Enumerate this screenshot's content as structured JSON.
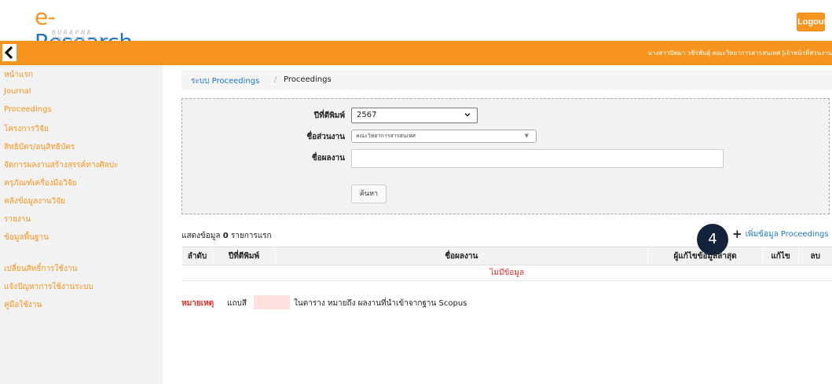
{
  "header": {
    "logo_prefix": "e-",
    "logo_name": "Research",
    "logo_sub": "BURAPHA UNIVERSITY",
    "logout_label": "Logout",
    "user_info": "นางสาวปัทมา วชิรพันธุ์  คณะวิทยาการสารสนเทศ  [เจ้าหน้าที่ส่วนงาน",
    "accent_color": "#f7941d",
    "link_color": "#1f76c9"
  },
  "sidebar": {
    "items": [
      {
        "label": "หน้าแรก"
      },
      {
        "label": "Journal"
      },
      {
        "label": "Proceedings"
      },
      {
        "label": "โครงการวิจัย"
      },
      {
        "label": "สิทธิบัตร/อนุสิทธิบัตร"
      },
      {
        "label": "จัดการผลงานสร้างสรรค์ทางศิลปะ"
      },
      {
        "label": "ครุภัณฑ์เครื่องมือวิจัย"
      },
      {
        "label": "คลังข้อมูลงานวิจัย"
      },
      {
        "label": "รายงาน"
      },
      {
        "label": "ข้อมูลพื้นฐาน"
      },
      {
        "label": "เปลี่ยนสิทธิ์การใช้งาน"
      },
      {
        "label": "แจ้งปัญหาการใช้งานระบบ"
      },
      {
        "label": "คู่มือใช้งาน"
      }
    ]
  },
  "breadcrumb": {
    "parent": "ระบบ Proceedings",
    "separator": "/",
    "current": "Proceedings"
  },
  "search": {
    "year_label": "ปีที่ตีพิมพ์",
    "year_value": "2567",
    "dept_label": "ชื่อส่วนงาน",
    "dept_value": "คณะวิทยาการสารสนเทศ",
    "work_label": "ชื่อผลงาน",
    "work_value": "",
    "search_button": "ค้นหา"
  },
  "results": {
    "count_prefix": "แสดงข้อมูล",
    "count": "0",
    "count_suffix": "รายการแรก",
    "add_label": "เพิ่มข้อมูล Proceedings",
    "step_badge": "4",
    "columns": [
      "ลำดับ",
      "ปีที่ตีพิมพ์",
      "ชื่อผลงาน",
      "ผู้แก้ไขข้อมูลล่าสุด",
      "แก้ไข",
      "ลบ"
    ],
    "empty_message": "ไม่มีข้อมูล"
  },
  "note": {
    "label": "หมายเหตุ",
    "pre": "แถบสี",
    "post": "ในตาราง หมายถึง ผลงานที่นำเข้าจากฐาน Scopus",
    "swatch_color": "#fde0e0"
  }
}
